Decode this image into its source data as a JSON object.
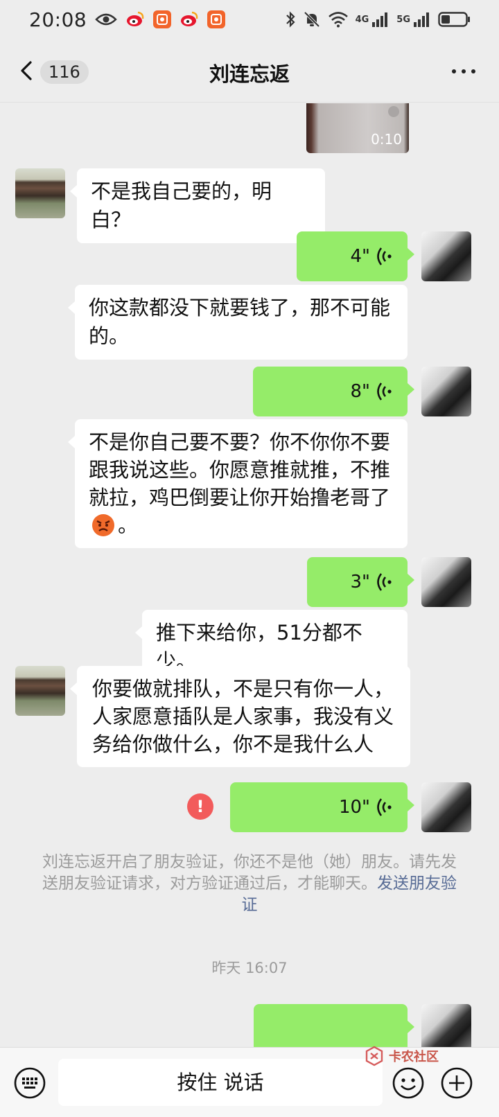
{
  "status_bar": {
    "time": "20:08",
    "net1": "4G",
    "net2": "5G"
  },
  "header": {
    "back_count": "116",
    "title": "刘连忘返"
  },
  "messages": {
    "video_duration": "0:10",
    "m1": "不是我自己要的，明白？",
    "voice1": "4\"",
    "m2": "你这款都没下就要钱了，那不可能的。",
    "voice2": "8\"",
    "m3": "不是你自己要不要？你不你你不要跟我说这些。你愿意推就推，不推就拉，鸡巴倒要让你开始撸老哥了",
    "m3_tail": "。",
    "voice3": "3\"",
    "m4": "推下来给你，51分都不少。",
    "m5": "你要做就排队，不是只有你一人，人家愿意插队是人家事，我没有义务给你做什么，你不是我什么人",
    "voice4": "10\"",
    "fail_mark": "!"
  },
  "system_notice": {
    "text": "刘连忘返开启了朋友验证，你还不是他（她）朋友。请先发送朋友验证请求，对方验证通过后，才能聊天。",
    "link": "发送朋友验证"
  },
  "timestamp": "昨天 16:07",
  "input_bar": {
    "hold_to_talk": "按住 说话"
  },
  "watermark": {
    "text": "卡农社区"
  },
  "colors": {
    "outgoing_bubble": "#95ec69",
    "incoming_bubble": "#ffffff",
    "background": "#ededed",
    "link": "#576b95",
    "error": "#f25b5b"
  }
}
